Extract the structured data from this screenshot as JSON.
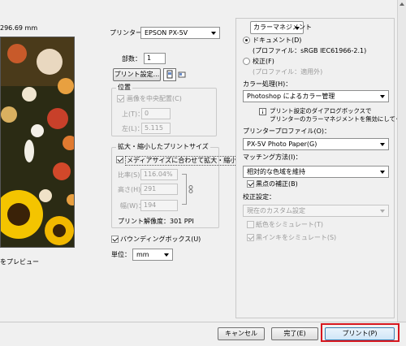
{
  "preview": {
    "size_label": "296.69 mm",
    "preview_label": "をプレビュー"
  },
  "printer": {
    "label": "プリンター：",
    "value": "EPSON PX-5V"
  },
  "copies": {
    "label": "部数：",
    "value": "1"
  },
  "print_settings_button": "プリント設定...",
  "position": {
    "title": "位置",
    "center_label": "画像を中央配置(C)",
    "top_label": "上(T)：",
    "top_value": "0",
    "left_label": "左(L)：",
    "left_value": "5.115"
  },
  "scaled": {
    "title": "拡大・縮小したプリントサイズ",
    "fit_label": "メディアサイズに合わせて拡大・縮小(M)",
    "scale_label": "比率(S)：",
    "scale_value": "116.04%",
    "height_label": "高さ(H)：",
    "height_value": "291",
    "width_label": "幅(W)：",
    "width_value": "194",
    "resolution": "プリント解像度：301 PPI"
  },
  "bounding_box_label": "バウンディングボックス(U)",
  "units": {
    "label": "単位：",
    "value": "mm"
  },
  "color_management": {
    "header": "カラーマネジメント",
    "document_label": "ドキュメント(D)",
    "document_profile": "(プロファイル：sRGB IEC61966-2.1)",
    "proof_label": "校正(F)",
    "proof_profile": "(プロファイル：適用外)",
    "color_handling_label": "カラー処理(H)：",
    "color_handling_value": "Photoshop によるカラー管理",
    "notice_line1": "プリント設定のダイアログボックスで",
    "notice_line2": "プリンターのカラーマネジメントを無効にしてください。",
    "printer_profile_label": "プリンタープロファイル(O)：",
    "printer_profile_value": "PX-5V Photo Paper(G)",
    "matching_label": "マッチング方法(I)：",
    "matching_value": "相対的な色域を維持",
    "bpc_label": "黒点の補正(B)",
    "proof_setup_label": "校正設定：",
    "proof_setup_value": "現在のカスタム設定",
    "sim_paper_label": "紙色をシミュレート(T)",
    "sim_ink_label": "黒インキをシミュレート(S)"
  },
  "buttons": {
    "cancel": "キャンセル",
    "done": "完了(E)",
    "print": "プリント(P)"
  },
  "colors": {
    "highlight": "#d7161e",
    "field_border": "#8e8f8f"
  }
}
